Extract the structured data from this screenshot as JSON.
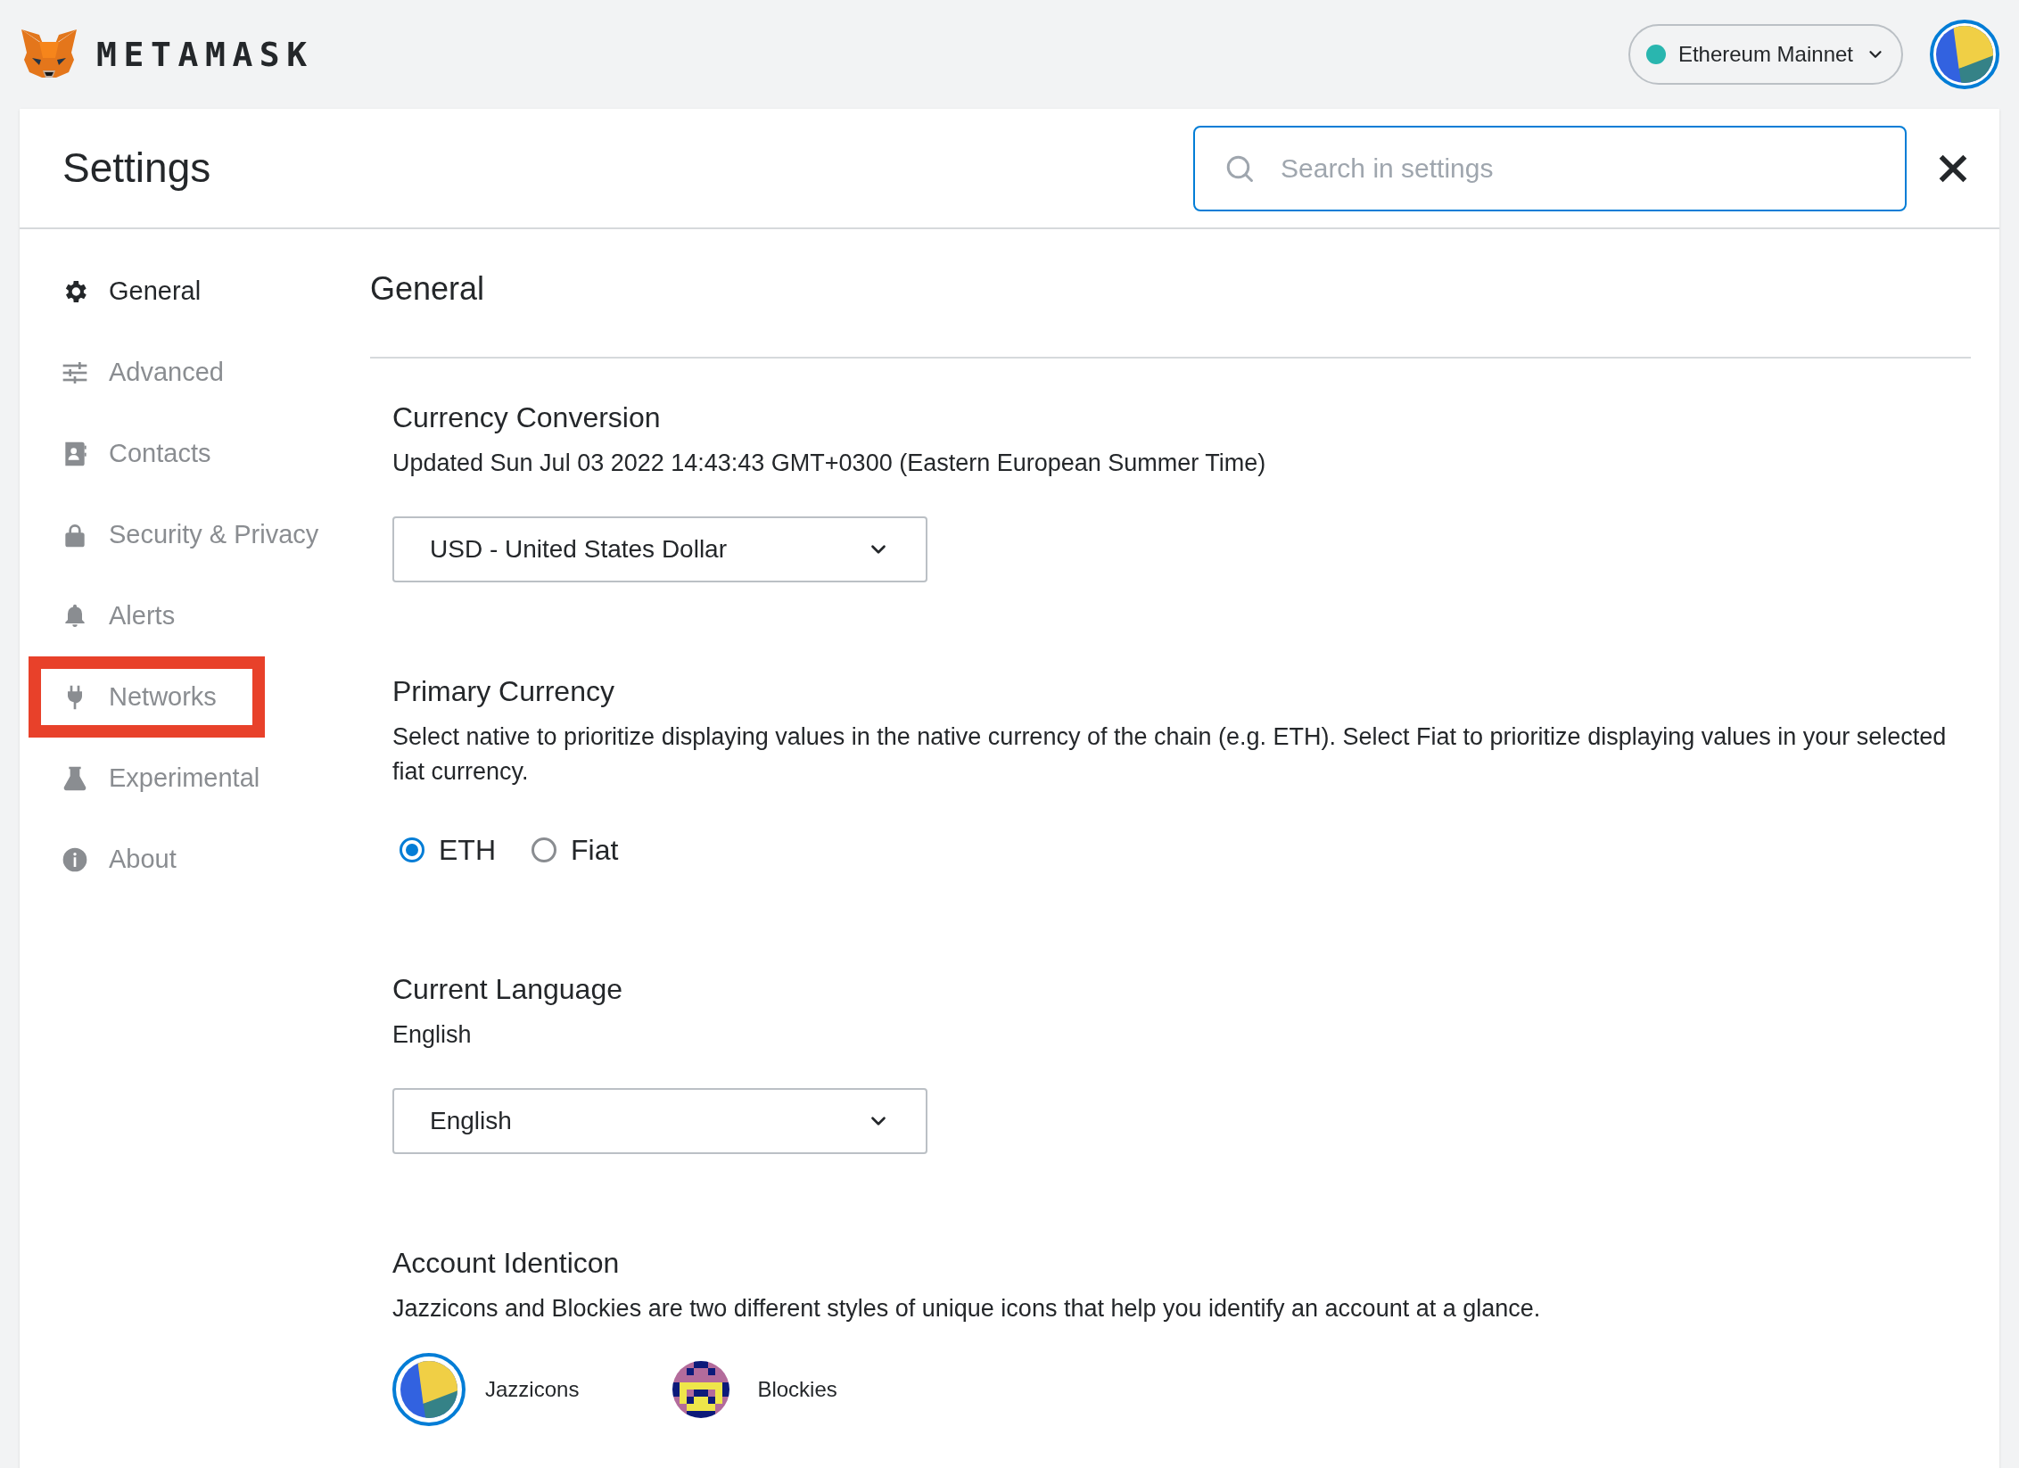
{
  "app": {
    "brand": "METAMASK",
    "network": "Ethereum Mainnet"
  },
  "header": {
    "title": "Settings",
    "search": {
      "placeholder": "Search in settings"
    }
  },
  "sidebar": {
    "items": [
      {
        "kind": "gear",
        "label": "General",
        "selected": true,
        "highlighted": false
      },
      {
        "kind": "sliders",
        "label": "Advanced",
        "selected": false,
        "highlighted": false
      },
      {
        "kind": "contacts",
        "label": "Contacts",
        "selected": false,
        "highlighted": false
      },
      {
        "kind": "lock",
        "label": "Security & Privacy",
        "selected": false,
        "highlighted": false
      },
      {
        "kind": "bell",
        "label": "Alerts",
        "selected": false,
        "highlighted": false
      },
      {
        "kind": "plug",
        "label": "Networks",
        "selected": false,
        "highlighted": true
      },
      {
        "kind": "flask",
        "label": "Experimental",
        "selected": false,
        "highlighted": false
      },
      {
        "kind": "info",
        "label": "About",
        "selected": false,
        "highlighted": false
      }
    ]
  },
  "content": {
    "title": "General",
    "sections": [
      {
        "kind": "dropdown",
        "title": "Currency Conversion",
        "description": "Updated Sun Jul 03 2022 14:43:43 GMT+0300 (Eastern European Summer Time)",
        "value": "USD - United States Dollar"
      },
      {
        "kind": "radio",
        "title": "Primary Currency",
        "description": "Select native to prioritize displaying values in the native currency of the chain (e.g. ETH). Select Fiat to prioritize displaying values in your selected fiat currency.",
        "options": [
          {
            "label": "ETH",
            "selected": true
          },
          {
            "label": "Fiat",
            "selected": false
          }
        ]
      },
      {
        "kind": "dropdown",
        "title": "Current Language",
        "description": "English",
        "value": "English"
      },
      {
        "kind": "identicon",
        "title": "Account Identicon",
        "description": "Jazzicons and Blockies are two different styles of unique icons that help you identify an account at a glance.",
        "options": [
          {
            "kind": "jazzicon",
            "label": "Jazzicons",
            "selected": true
          },
          {
            "kind": "blockie",
            "label": "Blockies",
            "selected": false
          }
        ]
      }
    ]
  }
}
